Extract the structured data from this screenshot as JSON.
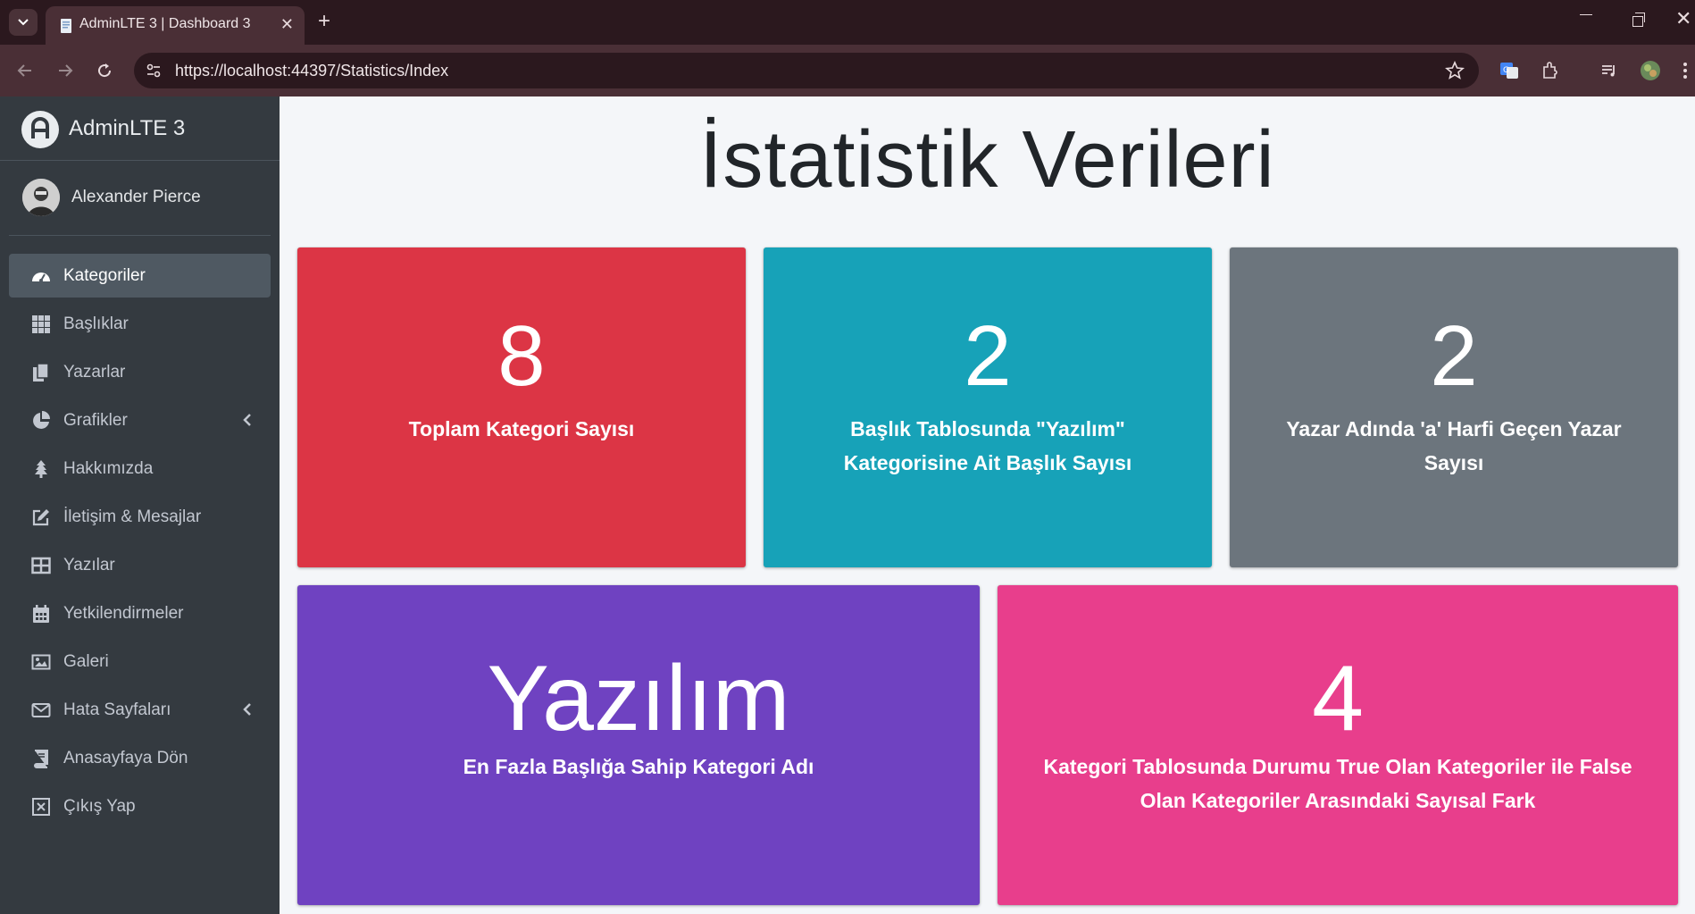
{
  "browser": {
    "tab_title": "AdminLTE 3 | Dashboard 3",
    "url": "https://localhost:44397/Statistics/Index",
    "new_tab_symbol": "+",
    "close_symbol": "✕"
  },
  "sidebar": {
    "brand": "AdminLTE 3",
    "user_name": "Alexander Pierce",
    "items": [
      {
        "label": "Kategoriler",
        "icon": "dashboard-icon",
        "active": true
      },
      {
        "label": "Başlıklar",
        "icon": "grid-icon"
      },
      {
        "label": "Yazarlar",
        "icon": "copy-icon"
      },
      {
        "label": "Grafikler",
        "icon": "pie-chart-icon",
        "has_submenu": true
      },
      {
        "label": "Hakkımızda",
        "icon": "tree-icon"
      },
      {
        "label": "İletişim & Mesajlar",
        "icon": "edit-icon"
      },
      {
        "label": "Yazılar",
        "icon": "table-icon"
      },
      {
        "label": "Yetkilendirmeler",
        "icon": "calendar-icon"
      },
      {
        "label": "Galeri",
        "icon": "image-icon"
      },
      {
        "label": "Hata Sayfaları",
        "icon": "envelope-icon",
        "has_submenu": true
      },
      {
        "label": "Anasayfaya Dön",
        "icon": "book-icon"
      },
      {
        "label": "Çıkış Yap",
        "icon": "close-square-icon"
      }
    ]
  },
  "main": {
    "title": "İstatistik Verileri",
    "boxes": [
      {
        "value": "8",
        "label": "Toplam Kategori Sayısı",
        "color": "#dc3545"
      },
      {
        "value": "2",
        "label": "Başlık Tablosunda \"Yazılım\" Kategorisine Ait Başlık Sayısı",
        "color": "#17a2b8"
      },
      {
        "value": "2",
        "label": "Yazar Adında 'a' Harfi Geçen Yazar Sayısı",
        "color": "#6c757d"
      },
      {
        "value": "Yazılım",
        "label": "En Fazla Başlığa Sahip Kategori Adı",
        "color": "#6f42c1"
      },
      {
        "value": "4",
        "label": "Kategori Tablosunda Durumu True Olan Kategoriler ile False Olan Kategoriler Arasındaki Sayısal Fark",
        "color": "#e83e8c"
      }
    ]
  }
}
